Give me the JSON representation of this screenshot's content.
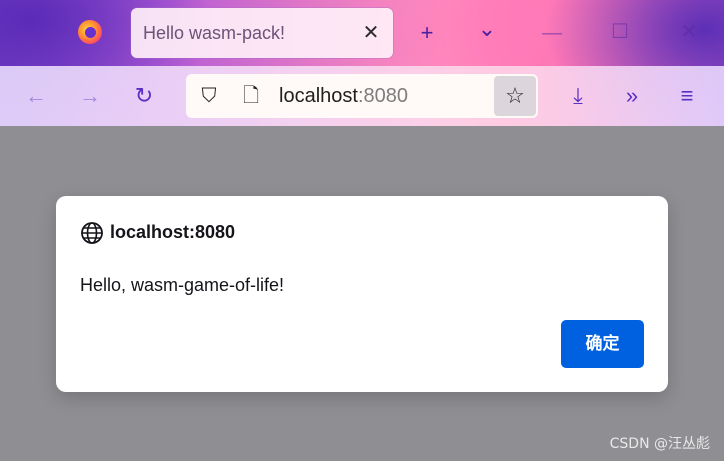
{
  "browser": {
    "tab": {
      "title": "Hello wasm-pack!",
      "close_glyph": "✕"
    },
    "tabbar_buttons": {
      "new_tab": "+",
      "tab_list": "⌄",
      "minimize": "—",
      "maximize": "☐",
      "close_window": "✕"
    },
    "nav": {
      "back": "←",
      "forward": "→",
      "reload": "↻",
      "downloads": "⤓",
      "overflow": "»",
      "menu": "≡"
    },
    "url": {
      "host": "localhost",
      "port": ":8080",
      "shield_glyph": "⛉",
      "page_glyph": "🗋",
      "star_glyph": "☆"
    }
  },
  "dialog": {
    "title": "localhost:8080",
    "message": "Hello, wasm-game-of-life!",
    "ok_label": "确定"
  },
  "watermark": "CSDN @汪丛彪",
  "colors": {
    "accent_button": "#0061e0",
    "page_overlay": "#8f8f93",
    "toolbar_icon": "#5a2fc4"
  }
}
